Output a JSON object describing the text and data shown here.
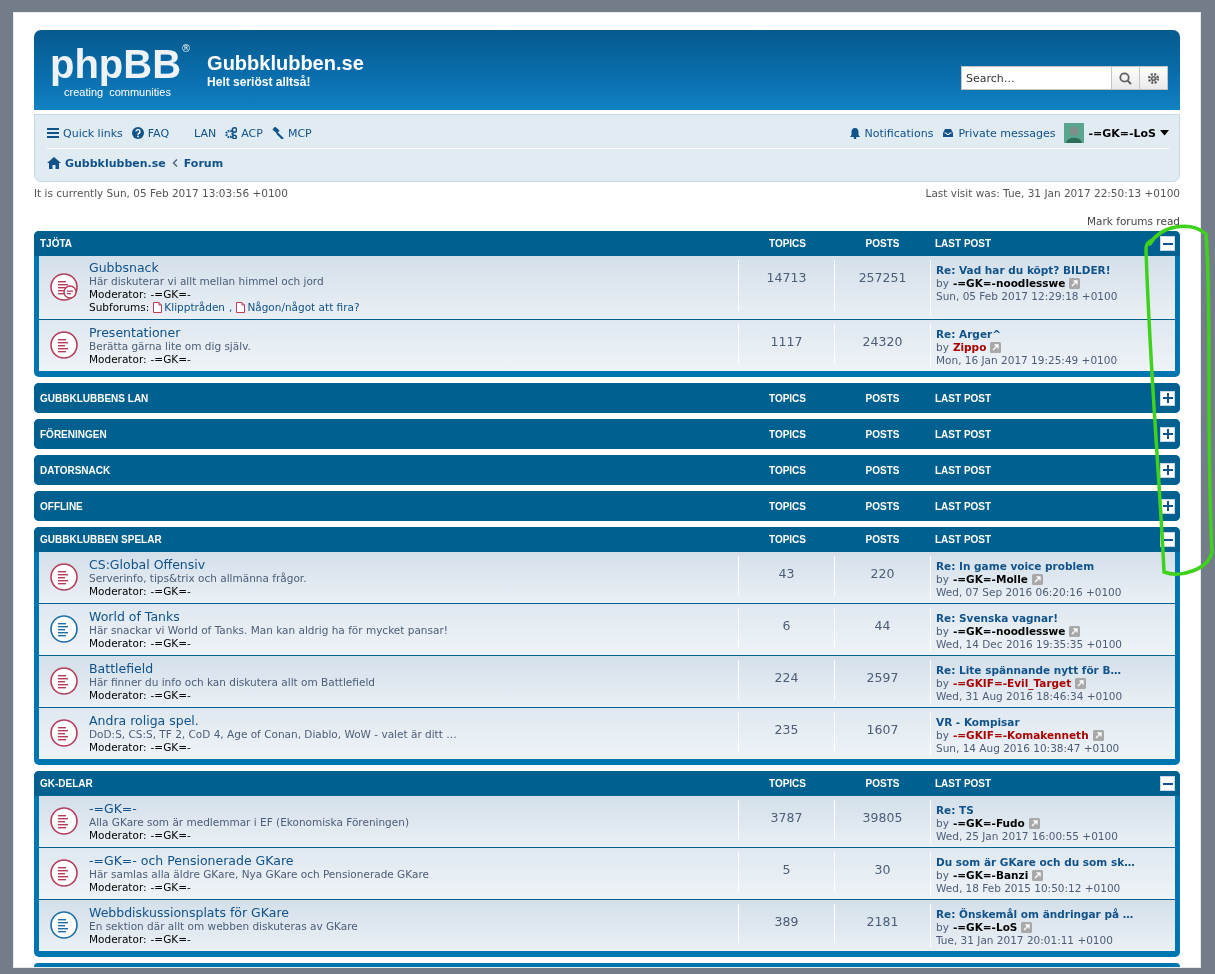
{
  "header": {
    "logo": {
      "word": "phpBB",
      "mark": "®",
      "tagline_1": "creating",
      "tagline_2": "communities"
    },
    "site_title": "Gubbklubben.se",
    "site_description": "Helt seriöst alltså!",
    "search": {
      "placeholder": "Search…"
    }
  },
  "navbar": {
    "left_links": [
      {
        "label": "Quick links"
      },
      {
        "label": "FAQ"
      },
      {
        "label": "LAN"
      },
      {
        "label": "ACP"
      },
      {
        "label": "MCP"
      }
    ],
    "right_links": [
      {
        "label": "Notifications"
      },
      {
        "label": "Private messages"
      }
    ],
    "user": {
      "name": "-=GK=-LoS"
    },
    "breadcrumbs": [
      "Gubbklubben.se",
      "Forum"
    ]
  },
  "current_time": "It is currently Sun, 05 Feb 2017 13:03:56 +0100",
  "last_visit": "Last visit was: Tue, 31 Jan 2017 22:50:13 +0100",
  "mark_read": "Mark forums read",
  "categories": [
    {
      "title": "TJÖTA",
      "columns": [
        "TOPICS",
        "POSTS",
        "LAST POST"
      ],
      "expanded": true,
      "forums": [
        {
          "name": "Gubbsnack",
          "description": "Här diskuterar vi allt mellan himmel och jord",
          "moderator_label": "Moderator:",
          "moderator": "-=GK=-",
          "subforums_label": "Subforums:",
          "subforums_separator": ",",
          "subforums": [
            "Klipptråden",
            "Någon/något att fira?"
          ],
          "unread": true,
          "topics": "14713",
          "posts": "257251",
          "last_post": {
            "title": "Re: Vad har du köpt? BILDER!",
            "by": "by",
            "author": {
              "name": "-=GK=-noodlesswe",
              "color": "#000000"
            },
            "time": "Sun, 05 Feb 2017 12:29:18 +0100"
          }
        },
        {
          "name": "Presentationer",
          "description": "Berätta gärna lite om dig själv.",
          "moderator_label": "Moderator:",
          "moderator": "-=GK=-",
          "unread": true,
          "topics": "1117",
          "posts": "24320",
          "last_post": {
            "title": "Re: Arger^",
            "by": "by",
            "author": {
              "name": "Zippo",
              "color": "#aa0000"
            },
            "time": "Mon, 16 Jan 2017 19:25:49 +0100"
          }
        }
      ]
    },
    {
      "title": "GUBBKLUBBENS LAN",
      "columns": [
        "TOPICS",
        "POSTS",
        "LAST POST"
      ],
      "expanded": false
    },
    {
      "title": "FÖRENINGEN",
      "columns": [
        "TOPICS",
        "POSTS",
        "LAST POST"
      ],
      "expanded": false
    },
    {
      "title": "DATORSNACK",
      "columns": [
        "TOPICS",
        "POSTS",
        "LAST POST"
      ],
      "expanded": false
    },
    {
      "title": "OFFLINE",
      "columns": [
        "TOPICS",
        "POSTS",
        "LAST POST"
      ],
      "expanded": false
    },
    {
      "title": "GUBBKLUBBEN SPELAR",
      "columns": [
        "TOPICS",
        "POSTS",
        "LAST POST"
      ],
      "expanded": true,
      "forums": [
        {
          "name": "CS:Global Offensiv",
          "description": "Serverinfo, tips&trix och allmänna frågor.",
          "moderator_label": "Moderator:",
          "moderator": "-=GK=-",
          "unread": true,
          "topics": "43",
          "posts": "220",
          "last_post": {
            "title": "Re: In game voice problem",
            "by": "by",
            "author": {
              "name": "-=GK=-Molle",
              "color": "#000000"
            },
            "time": "Wed, 07 Sep 2016 06:20:16 +0100"
          }
        },
        {
          "name": "World of Tanks",
          "description": "Här snackar vi World of Tanks. Man kan aldrig ha för mycket pansar!",
          "moderator_label": "Moderator:",
          "moderator": "-=GK=-",
          "unread": false,
          "topics": "6",
          "posts": "44",
          "last_post": {
            "title": "Re: Svenska vagnar!",
            "by": "by",
            "author": {
              "name": "-=GK=-noodlesswe",
              "color": "#000000"
            },
            "time": "Wed, 14 Dec 2016 19:35:35 +0100"
          }
        },
        {
          "name": "Battlefield",
          "description": "Här finner du info och kan diskutera allt om Battlefield",
          "moderator_label": "Moderator:",
          "moderator": "-=GK=-",
          "unread": true,
          "topics": "224",
          "posts": "2597",
          "last_post": {
            "title": "Re: Lite spännande nytt för B…",
            "by": "by",
            "author": {
              "name": "-=GKIF=-Evil_Target",
              "color": "#aa0000"
            },
            "time": "Wed, 31 Aug 2016 18:46:34 +0100"
          }
        },
        {
          "name": "Andra roliga spel.",
          "description": "DoD:S, CS:S, TF 2, CoD 4, Age of Conan, Diablo, WoW - valet är ditt …",
          "moderator_label": "Moderator:",
          "moderator": "-=GK=-",
          "unread": true,
          "topics": "235",
          "posts": "1607",
          "last_post": {
            "title": "VR - Kompisar",
            "by": "by",
            "author": {
              "name": "-=GKIF=-Komakenneth",
              "color": "#aa0000"
            },
            "time": "Sun, 14 Aug 2016 10:38:47 +0100"
          }
        }
      ]
    },
    {
      "title": "GK-DELAR",
      "columns": [
        "TOPICS",
        "POSTS",
        "LAST POST"
      ],
      "expanded": true,
      "forums": [
        {
          "name": "-=GK=-",
          "description": "Alla GKare som är medlemmar i EF (Ekonomiska Föreningen)",
          "moderator_label": "Moderator:",
          "moderator": "-=GK=-",
          "unread": true,
          "topics": "3787",
          "posts": "39805",
          "last_post": {
            "title": "Re: TS",
            "by": "by",
            "author": {
              "name": "-=GK=-Fudo",
              "color": "#000000"
            },
            "time": "Wed, 25 Jan 2017 16:00:55 +0100"
          }
        },
        {
          "name": "-=GK=- och Pensionerade GKare",
          "description": "Här samlas alla äldre GKare, Nya GKare och Pensionerade GKare",
          "moderator_label": "Moderator:",
          "moderator": "-=GK=-",
          "unread": true,
          "topics": "5",
          "posts": "30",
          "last_post": {
            "title": "Du som är GKare och du som sk…",
            "by": "by",
            "author": {
              "name": "-=GK=-Banzi",
              "color": "#000000"
            },
            "time": "Wed, 18 Feb 2015 10:50:12 +0100"
          }
        },
        {
          "name": "Webbdiskussionsplats för GKare",
          "description": "En sektion där allt om webben diskuteras av GKare",
          "moderator_label": "Moderator:",
          "moderator": "-=GK=-",
          "unread": false,
          "topics": "389",
          "posts": "2181",
          "last_post": {
            "title": "Re: Önskemål om ändringar på …",
            "by": "by",
            "author": {
              "name": "-=GK=-LoS",
              "color": "#000000"
            },
            "time": "Tue, 31 Jan 2017 20:01:11 +0100"
          }
        }
      ]
    }
  ]
}
